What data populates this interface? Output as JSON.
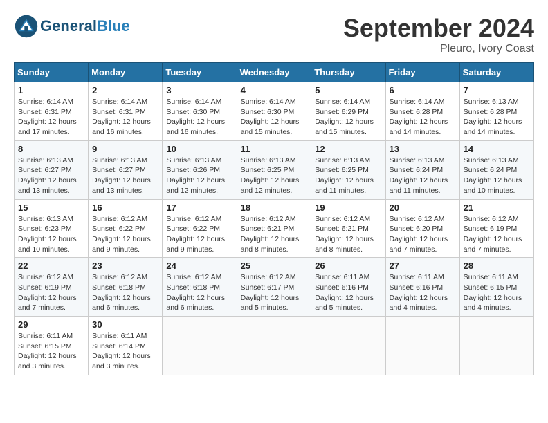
{
  "header": {
    "logo_general": "General",
    "logo_blue": "Blue",
    "month_title": "September 2024",
    "location": "Pleuro, Ivory Coast"
  },
  "calendar": {
    "headers": [
      "Sunday",
      "Monday",
      "Tuesday",
      "Wednesday",
      "Thursday",
      "Friday",
      "Saturday"
    ],
    "weeks": [
      [
        {
          "day": "1",
          "sunrise": "6:14 AM",
          "sunset": "6:31 PM",
          "daylight": "12 hours and 17 minutes."
        },
        {
          "day": "2",
          "sunrise": "6:14 AM",
          "sunset": "6:31 PM",
          "daylight": "12 hours and 16 minutes."
        },
        {
          "day": "3",
          "sunrise": "6:14 AM",
          "sunset": "6:30 PM",
          "daylight": "12 hours and 16 minutes."
        },
        {
          "day": "4",
          "sunrise": "6:14 AM",
          "sunset": "6:30 PM",
          "daylight": "12 hours and 15 minutes."
        },
        {
          "day": "5",
          "sunrise": "6:14 AM",
          "sunset": "6:29 PM",
          "daylight": "12 hours and 15 minutes."
        },
        {
          "day": "6",
          "sunrise": "6:14 AM",
          "sunset": "6:28 PM",
          "daylight": "12 hours and 14 minutes."
        },
        {
          "day": "7",
          "sunrise": "6:13 AM",
          "sunset": "6:28 PM",
          "daylight": "12 hours and 14 minutes."
        }
      ],
      [
        {
          "day": "8",
          "sunrise": "6:13 AM",
          "sunset": "6:27 PM",
          "daylight": "12 hours and 13 minutes."
        },
        {
          "day": "9",
          "sunrise": "6:13 AM",
          "sunset": "6:27 PM",
          "daylight": "12 hours and 13 minutes."
        },
        {
          "day": "10",
          "sunrise": "6:13 AM",
          "sunset": "6:26 PM",
          "daylight": "12 hours and 12 minutes."
        },
        {
          "day": "11",
          "sunrise": "6:13 AM",
          "sunset": "6:25 PM",
          "daylight": "12 hours and 12 minutes."
        },
        {
          "day": "12",
          "sunrise": "6:13 AM",
          "sunset": "6:25 PM",
          "daylight": "12 hours and 11 minutes."
        },
        {
          "day": "13",
          "sunrise": "6:13 AM",
          "sunset": "6:24 PM",
          "daylight": "12 hours and 11 minutes."
        },
        {
          "day": "14",
          "sunrise": "6:13 AM",
          "sunset": "6:24 PM",
          "daylight": "12 hours and 10 minutes."
        }
      ],
      [
        {
          "day": "15",
          "sunrise": "6:13 AM",
          "sunset": "6:23 PM",
          "daylight": "12 hours and 10 minutes."
        },
        {
          "day": "16",
          "sunrise": "6:12 AM",
          "sunset": "6:22 PM",
          "daylight": "12 hours and 9 minutes."
        },
        {
          "day": "17",
          "sunrise": "6:12 AM",
          "sunset": "6:22 PM",
          "daylight": "12 hours and 9 minutes."
        },
        {
          "day": "18",
          "sunrise": "6:12 AM",
          "sunset": "6:21 PM",
          "daylight": "12 hours and 8 minutes."
        },
        {
          "day": "19",
          "sunrise": "6:12 AM",
          "sunset": "6:21 PM",
          "daylight": "12 hours and 8 minutes."
        },
        {
          "day": "20",
          "sunrise": "6:12 AM",
          "sunset": "6:20 PM",
          "daylight": "12 hours and 7 minutes."
        },
        {
          "day": "21",
          "sunrise": "6:12 AM",
          "sunset": "6:19 PM",
          "daylight": "12 hours and 7 minutes."
        }
      ],
      [
        {
          "day": "22",
          "sunrise": "6:12 AM",
          "sunset": "6:19 PM",
          "daylight": "12 hours and 7 minutes."
        },
        {
          "day": "23",
          "sunrise": "6:12 AM",
          "sunset": "6:18 PM",
          "daylight": "12 hours and 6 minutes."
        },
        {
          "day": "24",
          "sunrise": "6:12 AM",
          "sunset": "6:18 PM",
          "daylight": "12 hours and 6 minutes."
        },
        {
          "day": "25",
          "sunrise": "6:12 AM",
          "sunset": "6:17 PM",
          "daylight": "12 hours and 5 minutes."
        },
        {
          "day": "26",
          "sunrise": "6:11 AM",
          "sunset": "6:16 PM",
          "daylight": "12 hours and 5 minutes."
        },
        {
          "day": "27",
          "sunrise": "6:11 AM",
          "sunset": "6:16 PM",
          "daylight": "12 hours and 4 minutes."
        },
        {
          "day": "28",
          "sunrise": "6:11 AM",
          "sunset": "6:15 PM",
          "daylight": "12 hours and 4 minutes."
        }
      ],
      [
        {
          "day": "29",
          "sunrise": "6:11 AM",
          "sunset": "6:15 PM",
          "daylight": "12 hours and 3 minutes."
        },
        {
          "day": "30",
          "sunrise": "6:11 AM",
          "sunset": "6:14 PM",
          "daylight": "12 hours and 3 minutes."
        },
        null,
        null,
        null,
        null,
        null
      ]
    ]
  }
}
